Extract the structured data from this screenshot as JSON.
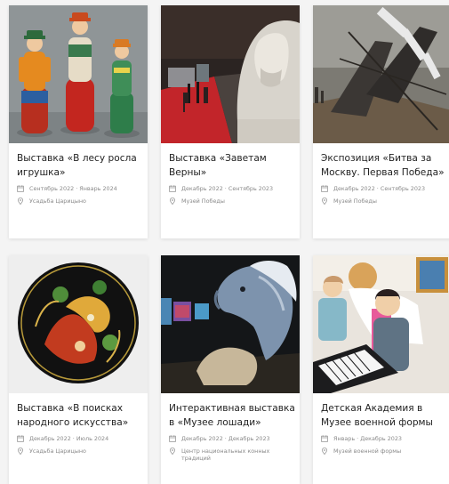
{
  "cards": [
    {
      "title": "Выставка «В лесу росла игрушка»",
      "dates": "Сентябрь 2022 · Январь 2024",
      "venue": "Усадьба Царицыно",
      "image": "wooden-dolls-photo"
    },
    {
      "title": "Выставка «Заветам Верны»",
      "dates": "Декабрь 2022 · Сентябрь 2023",
      "venue": "Музей Победы",
      "image": "museum-hall-bust-photo"
    },
    {
      "title": "Экспозиция «Битва за Москву. Первая Победа»",
      "dates": "Декабрь 2022 · Сентябрь 2023",
      "venue": "Музей Победы",
      "image": "battle-installation-photo"
    },
    {
      "title": "Выставка «В поисках народного искусства»",
      "dates": "Декабрь 2022 · Июль 2024",
      "venue": "Усадьба Царицыно",
      "image": "lacquer-plate-photo"
    },
    {
      "title": "Интерактивная выставка в «Музее лошади»",
      "dates": "Декабрь 2022 · Декабрь 2023",
      "venue": "Центр национальных конных традиций",
      "image": "horse-sculpture-photo"
    },
    {
      "title": "Детская Академия в Музее военной формы",
      "dates": "Январь · Декабрь 2023",
      "venue": "Музей военной формы",
      "image": "children-piano-photo"
    }
  ],
  "icons": {
    "date": "calendar-icon",
    "place": "location-pin-icon"
  }
}
